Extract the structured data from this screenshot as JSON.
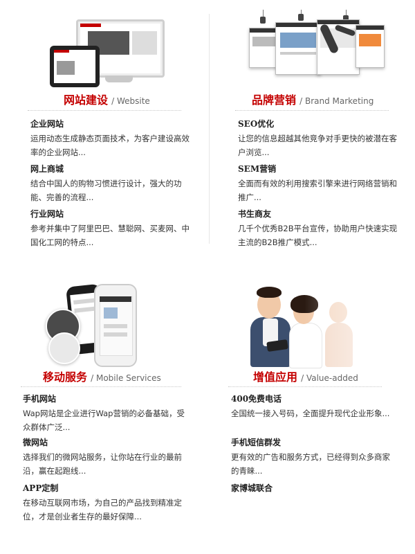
{
  "sections": [
    {
      "id": "website",
      "title_cn": "网站建设",
      "title_en": "/ Website",
      "items": [
        {
          "title": "企业网站",
          "desc": "运用动态生成静态页面技术，为客户建设高效率的企业网站..."
        },
        {
          "title": "网上商城",
          "desc": "结合中国人的购物习惯进行设计，强大的功能、完善的流程..."
        },
        {
          "title": "行业网站",
          "desc": "参考并集中了阿里巴巴、慧聪网、买麦网、中国化工网的特点..."
        }
      ]
    },
    {
      "id": "brand",
      "title_cn": "品牌营销",
      "title_en": "/ Brand Marketing",
      "items": [
        {
          "title": "SEO优化",
          "desc": "让您的信息超越其他竞争对手更快的被潜在客户浏览..."
        },
        {
          "title": "SEM营销",
          "desc": "全面而有效的利用搜索引擎来进行网络营销和推广..."
        },
        {
          "title": "书生商友",
          "desc": "几千个优秀B2B平台宣传，协助用户快速实现主流的B2B推广模式..."
        }
      ]
    },
    {
      "id": "mobile",
      "title_cn": "移动服务",
      "title_en": "/ Mobile Services",
      "items": [
        {
          "title": "手机网站",
          "desc": "Wap网站是企业进行Wap营销的必备基础，受众群体广泛..."
        },
        {
          "title": "微网站",
          "desc": "选择我们的微网站服务，让你站在行业的最前沿，赢在起跑线..."
        },
        {
          "title": "APP定制",
          "desc": "在移动互联网市场，为自己的产品找到精准定位，才是创业者生存的最好保障..."
        }
      ]
    },
    {
      "id": "value",
      "title_cn": "增值应用",
      "title_en": "/ Value-added",
      "items": [
        {
          "title": "400免费电话",
          "desc": "全国统一接入号码，全面提升现代企业形象..."
        },
        {
          "title": "手机短信群发",
          "desc": "更有效的广告和服务方式，已经得到众多商家的青睐..."
        },
        {
          "title": "家博城联合",
          "desc": ""
        }
      ]
    }
  ],
  "colors": {
    "accent": "#c40000",
    "divider": "#c8c8c8"
  },
  "icons": [
    "monitor-tablet-illustration",
    "webpages-display-illustration",
    "smartphones-illustration",
    "business-people-photo"
  ]
}
